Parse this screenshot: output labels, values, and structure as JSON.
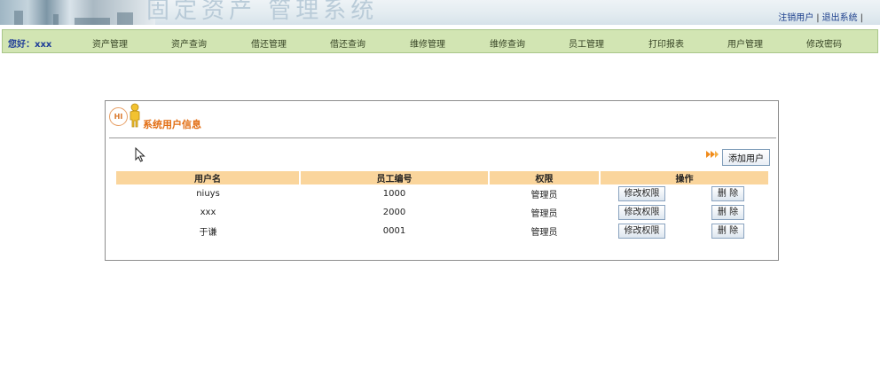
{
  "header": {
    "title": "固定资产 管理系统",
    "links": [
      "注销用户",
      "退出系统"
    ]
  },
  "nav": {
    "greeting": "您好：xxx",
    "items": [
      "资产管理",
      "资产查询",
      "借还管理",
      "借还查询",
      "维修管理",
      "维修查询",
      "员工管理",
      "打印报表",
      "用户管理",
      "修改密码"
    ]
  },
  "panel": {
    "badge": "HI",
    "title": "系统用户信息",
    "add_button": "添加用户"
  },
  "table": {
    "columns": [
      "用户名",
      "员工编号",
      "权限",
      "操作"
    ],
    "rows": [
      {
        "username": "niuys",
        "emp_no": "1000",
        "role": "管理员",
        "edit": "修改权限",
        "delete": "删 除"
      },
      {
        "username": "xxx",
        "emp_no": "2000",
        "role": "管理员",
        "edit": "修改权限",
        "delete": "删 除"
      },
      {
        "username": "于谦",
        "emp_no": "0001",
        "role": "管理员",
        "edit": "修改权限",
        "delete": "删 除"
      }
    ]
  },
  "colors": {
    "nav_bg": "#d2e5b3",
    "table_header_bg": "#fad59c",
    "panel_title": "#e26d12",
    "greeting": "#1f3d98"
  },
  "icons": [
    "hi-badge-icon",
    "person-icon",
    "double-arrow-icon",
    "mouse-cursor-icon"
  ]
}
